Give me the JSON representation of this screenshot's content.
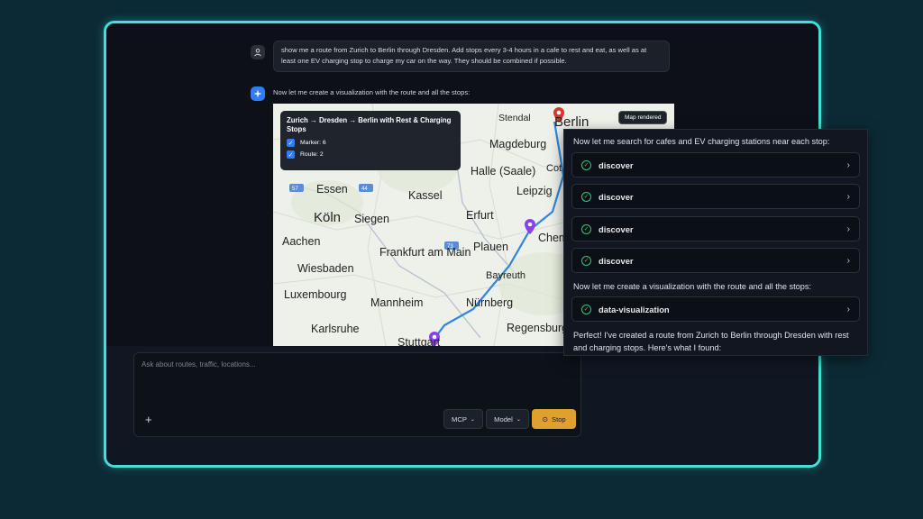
{
  "chat": {
    "user_message": "show me a route from Zurich to Berlin through Dresden. Add stops every 3-4 hours in a cafe to rest and eat, as well as at least one EV charging stop to charge my car on the way. They should be combined if possible.",
    "ai_intro": "Now let me create a visualization with the route and all the stops:"
  },
  "map": {
    "legend_title": "Zurich → Dresden → Berlin with Rest & Charging Stops",
    "legend_items": [
      "Marker: 6",
      "Route: 2"
    ],
    "badge": "Map rendered",
    "cities": [
      "Berlin",
      "Stendal",
      "Magdeburg",
      "Halle (Saale)",
      "Leipzig",
      "Essen",
      "Kassel",
      "Köln",
      "Siegen",
      "Erfurt",
      "Aachen",
      "Frankfurt am Main",
      "Plauen",
      "Chem",
      "Wiesbaden",
      "Bayreuth",
      "Luxembourg",
      "Mannheim",
      "Nürnberg",
      "Karlsruhe",
      "Regensburg",
      "Stuttgart",
      "Cot"
    ],
    "road_numbers": [
      "57",
      "44",
      "73"
    ]
  },
  "overlay": {
    "search_text": "Now let me search for cafes and EV charging stations near each stop:",
    "tools": [
      "discover",
      "discover",
      "discover",
      "discover"
    ],
    "viz_text": "Now let me create a visualization with the route and all the stops:",
    "viz_tool": "data-visualization",
    "final_text": "Perfect! I've created a route from Zurich to Berlin through Dresden with rest and charging stops. Here's what I found:"
  },
  "input": {
    "placeholder": "Ask about routes, traffic, locations...",
    "plus": "+",
    "mcp": "MCP",
    "model": "Model",
    "stop": "Stop"
  },
  "colors": {
    "accent_frame": "#3ee0d8",
    "route": "#2f86e0",
    "marker_red": "#e0322d",
    "marker_purple": "#8b3fe6",
    "stop_button": "#e0a030"
  }
}
